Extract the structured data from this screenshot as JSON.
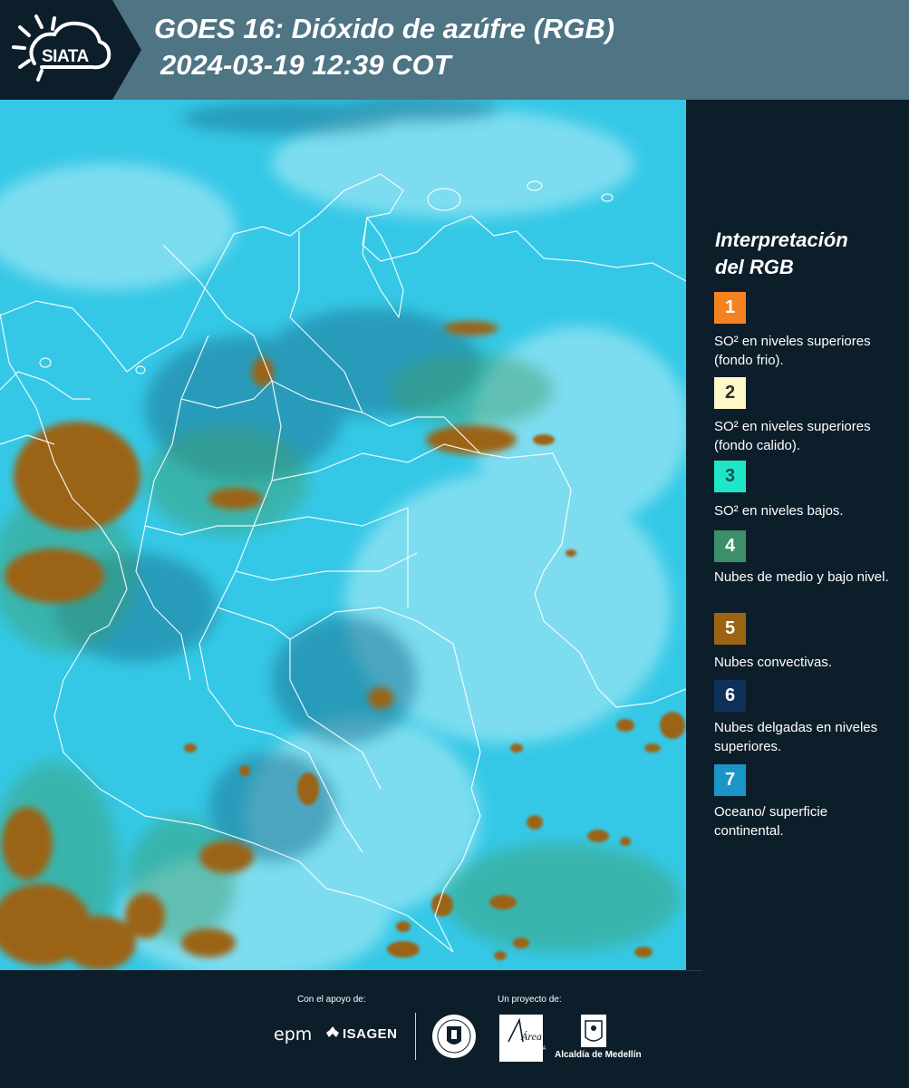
{
  "header": {
    "logo_text": "SIATA",
    "title": "GOES 16: Dióxido de azúfre (RGB)",
    "subtitle": "2024-03-19 12:39 COT"
  },
  "legend": {
    "title_line1": "Interpretación",
    "title_line2": "del RGB",
    "items": [
      {
        "number": "1",
        "color": "#f58220",
        "text_color": "#ffffff",
        "label": "SO² en niveles superiores (fondo frio)."
      },
      {
        "number": "2",
        "color": "#fef7c8",
        "text_color": "#2b2b2b",
        "label": "SO² en niveles superiores (fondo calido)."
      },
      {
        "number": "3",
        "color": "#1fe6c8",
        "text_color": "#1b4d4d",
        "label": "SO² en niveles bajos."
      },
      {
        "number": "4",
        "color": "#3c8f68",
        "text_color": "#ffffff",
        "label": "Nubes de medio y bajo nivel."
      },
      {
        "number": "5",
        "color": "#9b6413",
        "text_color": "#ffffff",
        "label": "Nubes convectivas."
      },
      {
        "number": "6",
        "color": "#10305c",
        "text_color": "#ffffff",
        "label": "Nubes delgadas en niveles superiores."
      },
      {
        "number": "7",
        "color": "#1a95c8",
        "text_color": "#ffffff",
        "label": "Oceano/ superficie continental."
      }
    ]
  },
  "footer": {
    "support_label": "Con el apoyo de:",
    "project_label": "Un proyecto de:",
    "sponsor_epm": "epm",
    "sponsor_isagen": "ISAGEN",
    "area_logo_text": "Área",
    "area_caption": "METROPOLITANA Valle de Aburrá",
    "alcaldia_label": "Alcaldía de Medellín"
  },
  "colors": {
    "background": "#0d1e2b",
    "header_band": "#4f7483",
    "ocean_surface": "#35c8e6",
    "convective": "#9b6413",
    "boundaries": "#ffffff"
  }
}
